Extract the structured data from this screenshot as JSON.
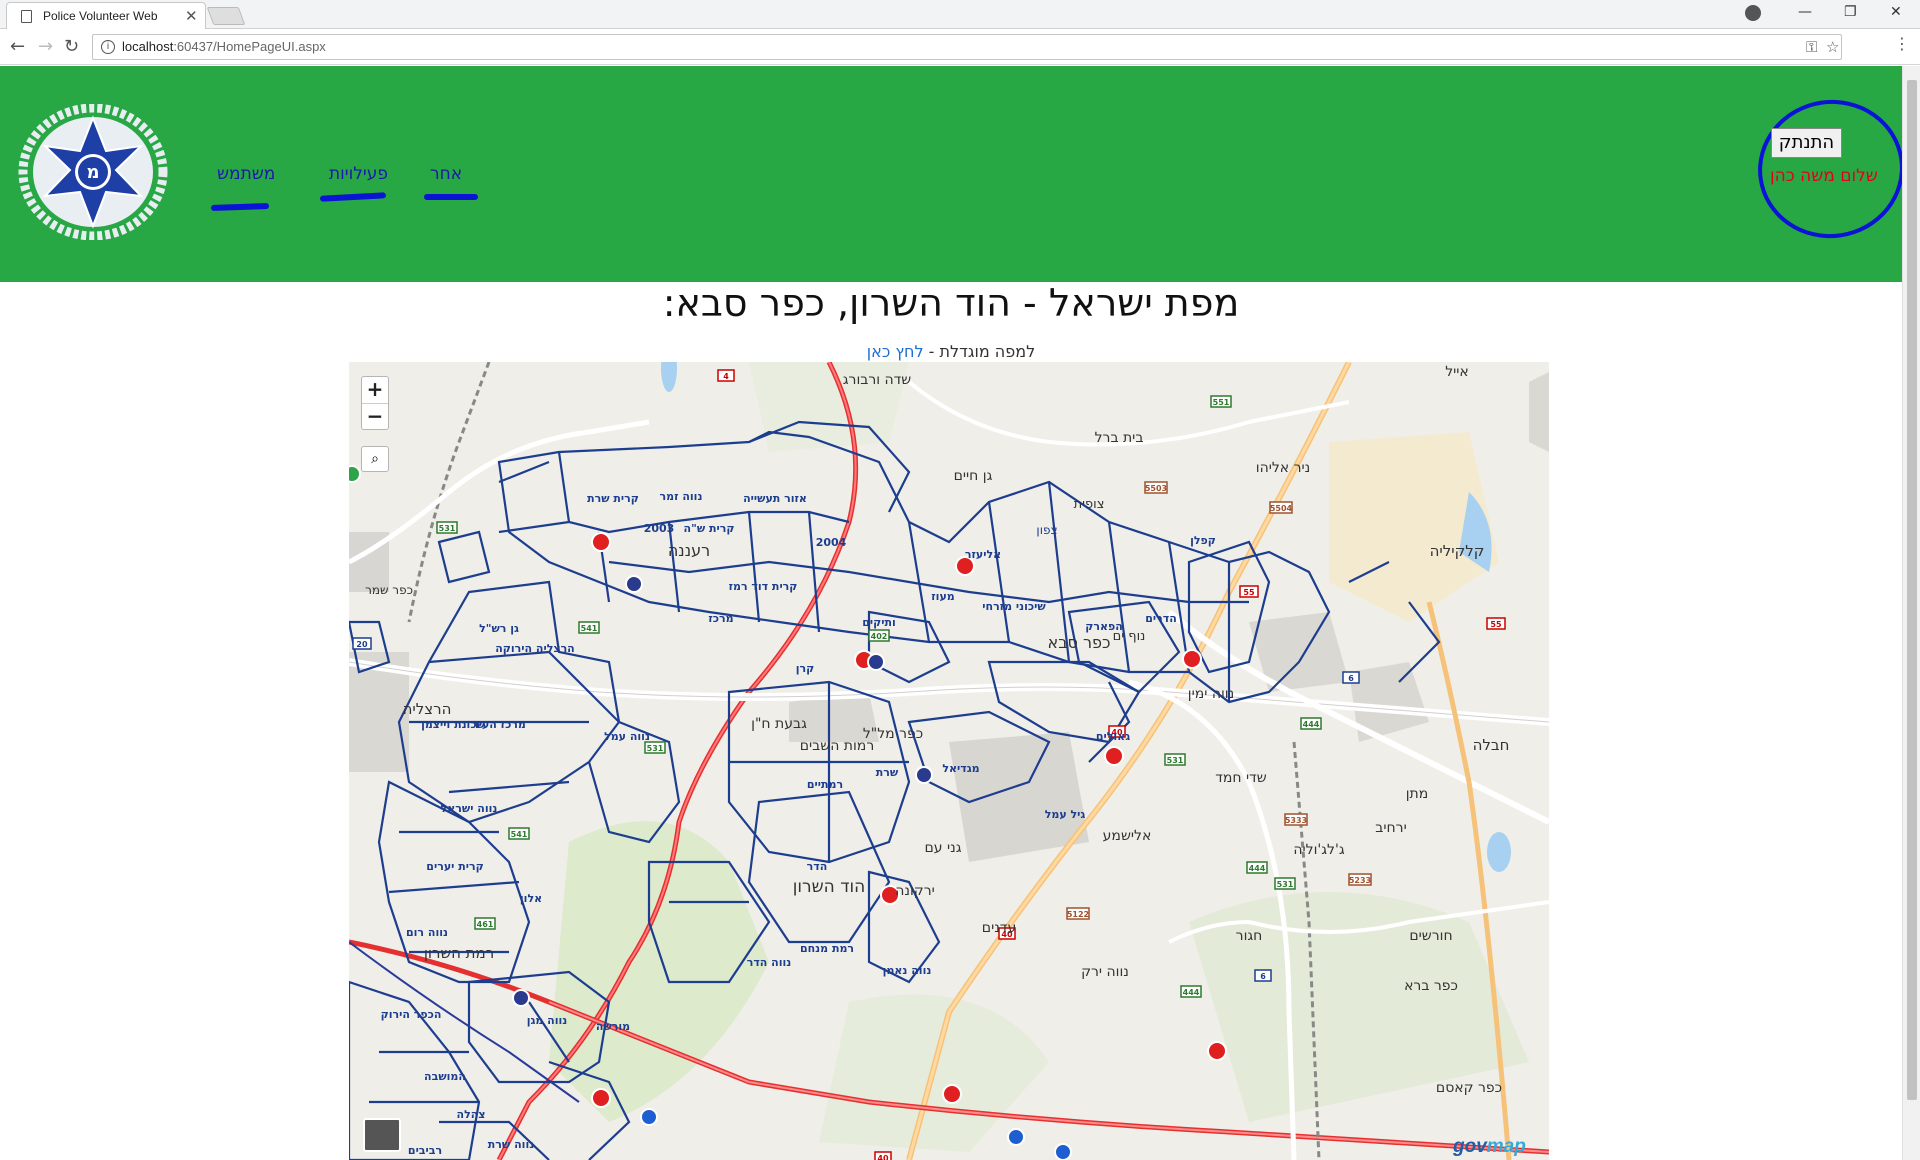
{
  "browser": {
    "tab_title": "Police Volunteer Web",
    "url_host": "localhost",
    "url_rest": ":60437/HomePageUI.aspx"
  },
  "header": {
    "nav": {
      "users": "משתמש",
      "activities": "פעילויות",
      "other": "אחר"
    },
    "logout_label": "התנתק",
    "greeting": "שלום משה כהן"
  },
  "main": {
    "title": "מפת ישראל - הוד השרון, כפר סבא:",
    "subtitle_prefix": "למפה מוגדלת - ",
    "subtitle_link": "לחץ כאן"
  },
  "map": {
    "zoom_in": "+",
    "zoom_out": "−",
    "brand_1": "gov",
    "brand_2": "map",
    "labels": {
      "ranana": "רעננה",
      "kfar_saba": "כפר סבא",
      "hod_hasharon": "הוד השרון",
      "herzliya": "הרצליה",
      "ramat_hasharon": "רמת השרון",
      "kalkilya": "קלקיליה",
      "neve_yamin": "נווה ימין",
      "sde_varburg": "שדה ורבורג",
      "beit_berl": "בית ברל",
      "gan_haim": "גן חיים",
      "tsofit": "צופית",
      "tzafon": "צפון",
      "nir_eliyahu": "ניר אליהו",
      "eyal": "אייל",
      "havala": "חבלה",
      "sde_hemed": "שדי חמד",
      "matan": "מתן",
      "yarhiv": "ירחיב",
      "jaljulia": "ג'לג'וליה",
      "elishama": "אלישמע",
      "hagor": "חגור",
      "horashim": "חורשים",
      "kfar_bara": "כפר ברא",
      "kfar_kasem": "כפר קאסם",
      "neve_yarak": "נווה ירק",
      "adanim": "עדנים",
      "yarkona": "ירקונה",
      "gane_am": "גני עם",
      "kfar_malal": "כפר מל\"ל",
      "ramot_hashavim": "רמות השבים",
      "givat_hen": "גבעת ח\"ן",
      "herzliya_pituah": "הרצליה הירוקה",
      "kfar_shmaryahu": "כפר שמר",
      "neve_amal": "נווה עמל",
      "gil_amal": "גיל עמל",
      "neve_ne_eman": "נווה נאמן",
      "ramat_menachem": "רמת מנחם",
      "neve_hadar": "נווה הדר",
      "ramtaim": "רמתיים",
      "sharet": "שרת",
      "migdiel": "מגדיאל",
      "keren": "קרן",
      "merkaz": "מרכז",
      "kiryat_david_remez": "קרית דוד רמז",
      "neve_zemer": "נווה זמר",
      "kiryat_sharet": "קרית שרת",
      "ezor_taasiya": "אזור תעשייה",
      "vatikim": "ותיקים",
      "alyahu": "אליעזר",
      "hadarim": "הדרים",
      "kaplan": "קפלן",
      "hapark": "הפארק",
      "geulim": "גאולים",
      "meod": "מעוז",
      "mizrachi": "שיכוני מזרחי",
      "morasha": "מורשה",
      "neve_magen": "נווה מגן",
      "kfar_hayarok": "הכפר הירוק",
      "neve_rom": "נווה רום",
      "alon": "אלון",
      "kiryat_yearim": "קרית יערים",
      "hamoshava": "המושבה",
      "tsahala": "צהלה",
      "neve_sharet": "נווה שרת",
      "ravivim": "רביבים",
      "neve_israel": "נווה ישראל",
      "merkaz_hair": "מרכז העיר",
      "weizmann": "שכונת וייצמן",
      "gan_rash": "גן רש\"ל",
      "kiryat_2003": "2003",
      "yr_2004": "2004",
      "kiryat_shah": "קרית ש\"ה",
      "kfar_malal_short": "כפר מל\"ל",
      "hadar": "הדר",
      "kiryat_yam": "נוף ים"
    },
    "road_shields": [
      "4",
      "551",
      "5503",
      "5504",
      "531",
      "541",
      "55",
      "55",
      "6",
      "444",
      "402",
      "20",
      "40",
      "5333",
      "531",
      "5233",
      "444",
      "5122",
      "40",
      "444",
      "6",
      "531",
      "531",
      "541",
      "461",
      "40"
    ]
  }
}
